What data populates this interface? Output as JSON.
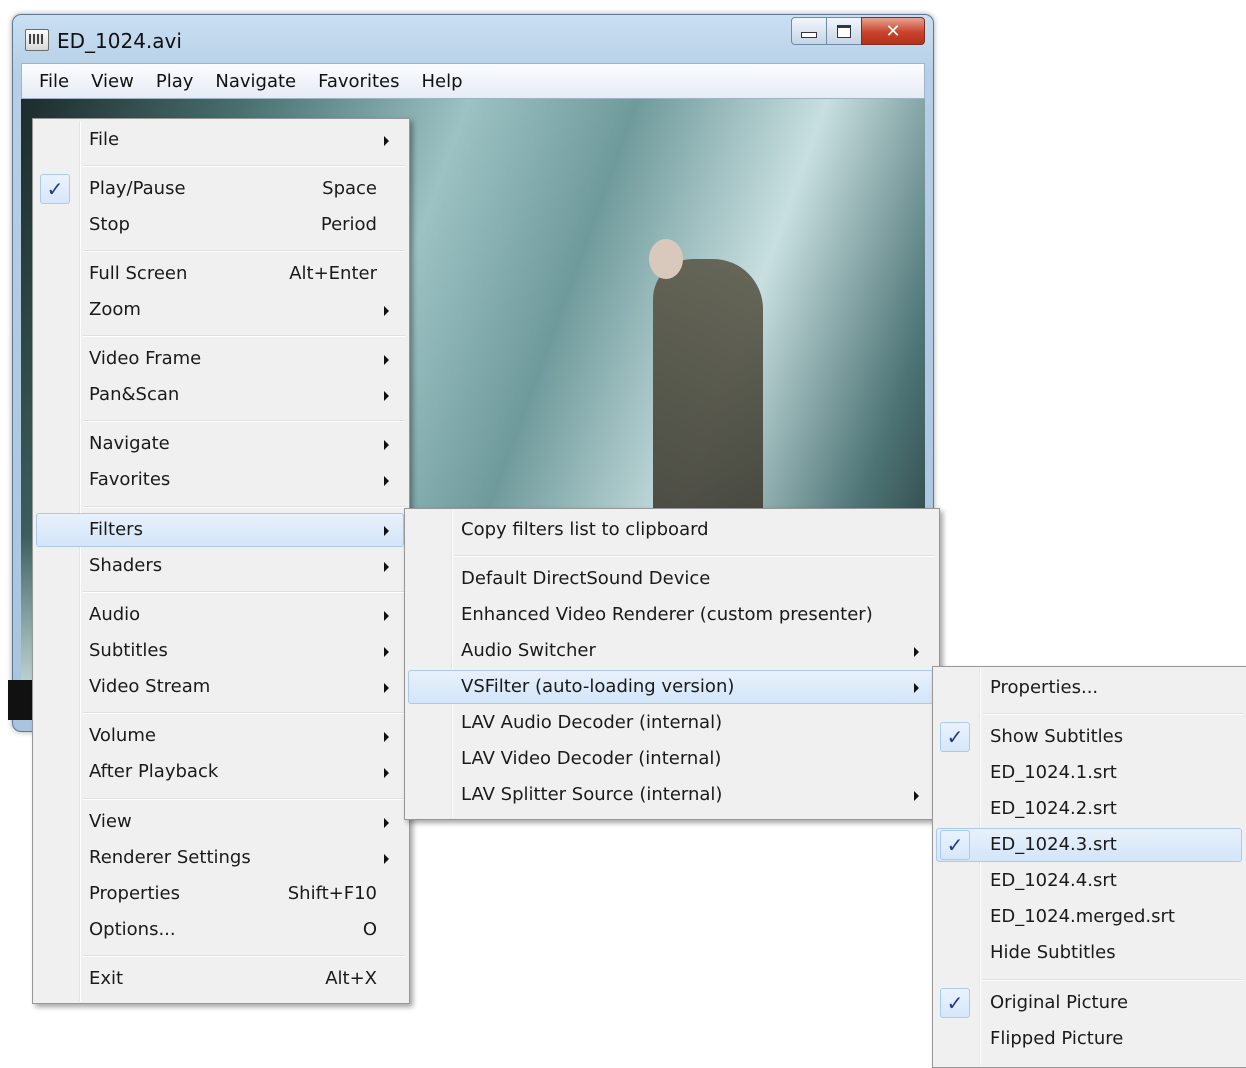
{
  "window": {
    "title": "ED_1024.avi",
    "buttons": {
      "minimize": "minimize-icon",
      "maximize": "maximize-icon",
      "close_label": "✕"
    }
  },
  "menubar": [
    "File",
    "View",
    "Play",
    "Navigate",
    "Favorites",
    "Help"
  ],
  "context_menu": {
    "items": [
      {
        "label": "File",
        "submenu": true
      },
      {
        "label": "Play/Pause",
        "shortcut": "Space",
        "checked": true
      },
      {
        "label": "Stop",
        "shortcut": "Period"
      },
      {
        "label": "Full Screen",
        "shortcut": "Alt+Enter"
      },
      {
        "label": "Zoom",
        "submenu": true
      },
      {
        "label": "Video Frame",
        "submenu": true
      },
      {
        "label": "Pan&Scan",
        "submenu": true
      },
      {
        "label": "Navigate",
        "submenu": true
      },
      {
        "label": "Favorites",
        "submenu": true
      },
      {
        "label": "Filters",
        "submenu": true,
        "highlighted": true
      },
      {
        "label": "Shaders",
        "submenu": true
      },
      {
        "label": "Audio",
        "submenu": true
      },
      {
        "label": "Subtitles",
        "submenu": true
      },
      {
        "label": "Video Stream",
        "submenu": true
      },
      {
        "label": "Volume",
        "submenu": true
      },
      {
        "label": "After Playback",
        "submenu": true
      },
      {
        "label": "View",
        "submenu": true
      },
      {
        "label": "Renderer Settings",
        "submenu": true
      },
      {
        "label": "Properties",
        "shortcut": "Shift+F10"
      },
      {
        "label": "Options...",
        "shortcut": "O"
      },
      {
        "label": "Exit",
        "shortcut": "Alt+X"
      }
    ]
  },
  "filters_menu": {
    "items": [
      {
        "label": "Copy filters list to clipboard"
      },
      {
        "label": "Default DirectSound Device"
      },
      {
        "label": "Enhanced Video Renderer (custom presenter)"
      },
      {
        "label": "Audio Switcher",
        "submenu": true
      },
      {
        "label": "VSFilter (auto-loading version)",
        "submenu": true,
        "highlighted": true
      },
      {
        "label": "LAV Audio Decoder (internal)"
      },
      {
        "label": "LAV Video Decoder (internal)"
      },
      {
        "label": "LAV Splitter Source (internal)",
        "submenu": true
      }
    ]
  },
  "vsfilter_menu": {
    "items": [
      {
        "label": "Properties..."
      },
      {
        "label": "Show Subtitles",
        "checked": true
      },
      {
        "label": "ED_1024.1.srt"
      },
      {
        "label": "ED_1024.2.srt"
      },
      {
        "label": "ED_1024.3.srt",
        "checked": true,
        "highlighted": true
      },
      {
        "label": "ED_1024.4.srt"
      },
      {
        "label": "ED_1024.merged.srt"
      },
      {
        "label": "Hide Subtitles"
      },
      {
        "label": "Original Picture",
        "checked": true
      },
      {
        "label": "Flipped Picture"
      }
    ]
  },
  "check_glyph": "✓"
}
